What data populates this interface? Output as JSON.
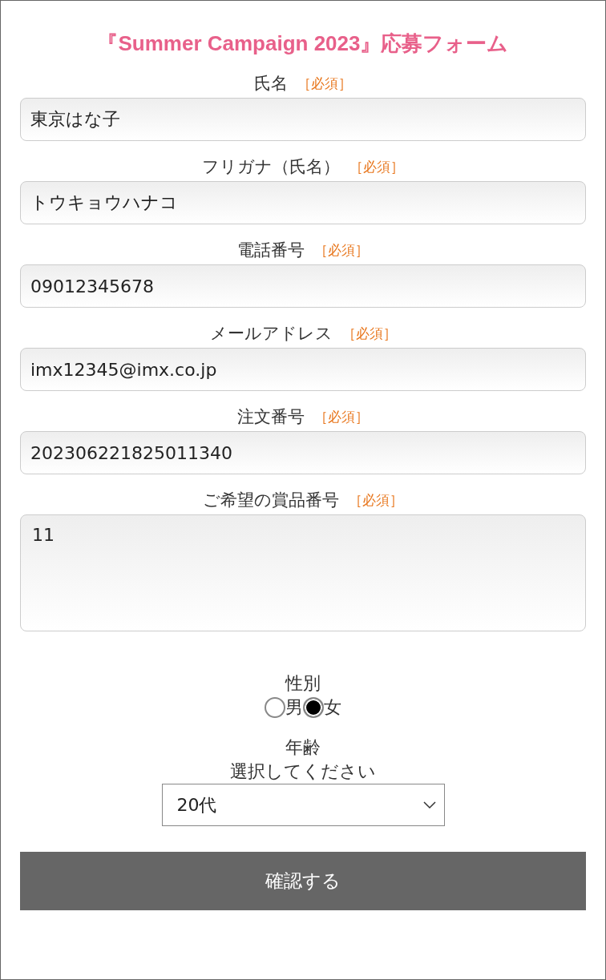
{
  "title": "『Summer Campaign 2023』応募フォーム",
  "fields": [
    {
      "kind": "text",
      "label": "氏名",
      "required_mark": "［必須］",
      "value": "東京はな子"
    },
    {
      "kind": "text",
      "label": "フリガナ（氏名）",
      "required_mark": "［必須］",
      "value": "トウキョウハナコ"
    },
    {
      "kind": "text",
      "label": "電話番号",
      "required_mark": "［必須］",
      "value": "09012345678"
    },
    {
      "kind": "text",
      "label": "メールアドレス",
      "required_mark": "［必須］",
      "value": "imx12345@imx.co.jp"
    },
    {
      "kind": "text",
      "label": "注文番号",
      "required_mark": "［必須］",
      "value": "202306221825011340"
    },
    {
      "kind": "textarea",
      "label": "ご希望の賞品番号",
      "required_mark": "［必須］",
      "value": "11"
    }
  ],
  "gender": {
    "label": "性別",
    "options": [
      {
        "label": "男",
        "selected": false
      },
      {
        "label": "女",
        "selected": true
      }
    ]
  },
  "age": {
    "label": "年齢",
    "hint": "選択してください",
    "value": "20代"
  },
  "submit_button": "確認する"
}
